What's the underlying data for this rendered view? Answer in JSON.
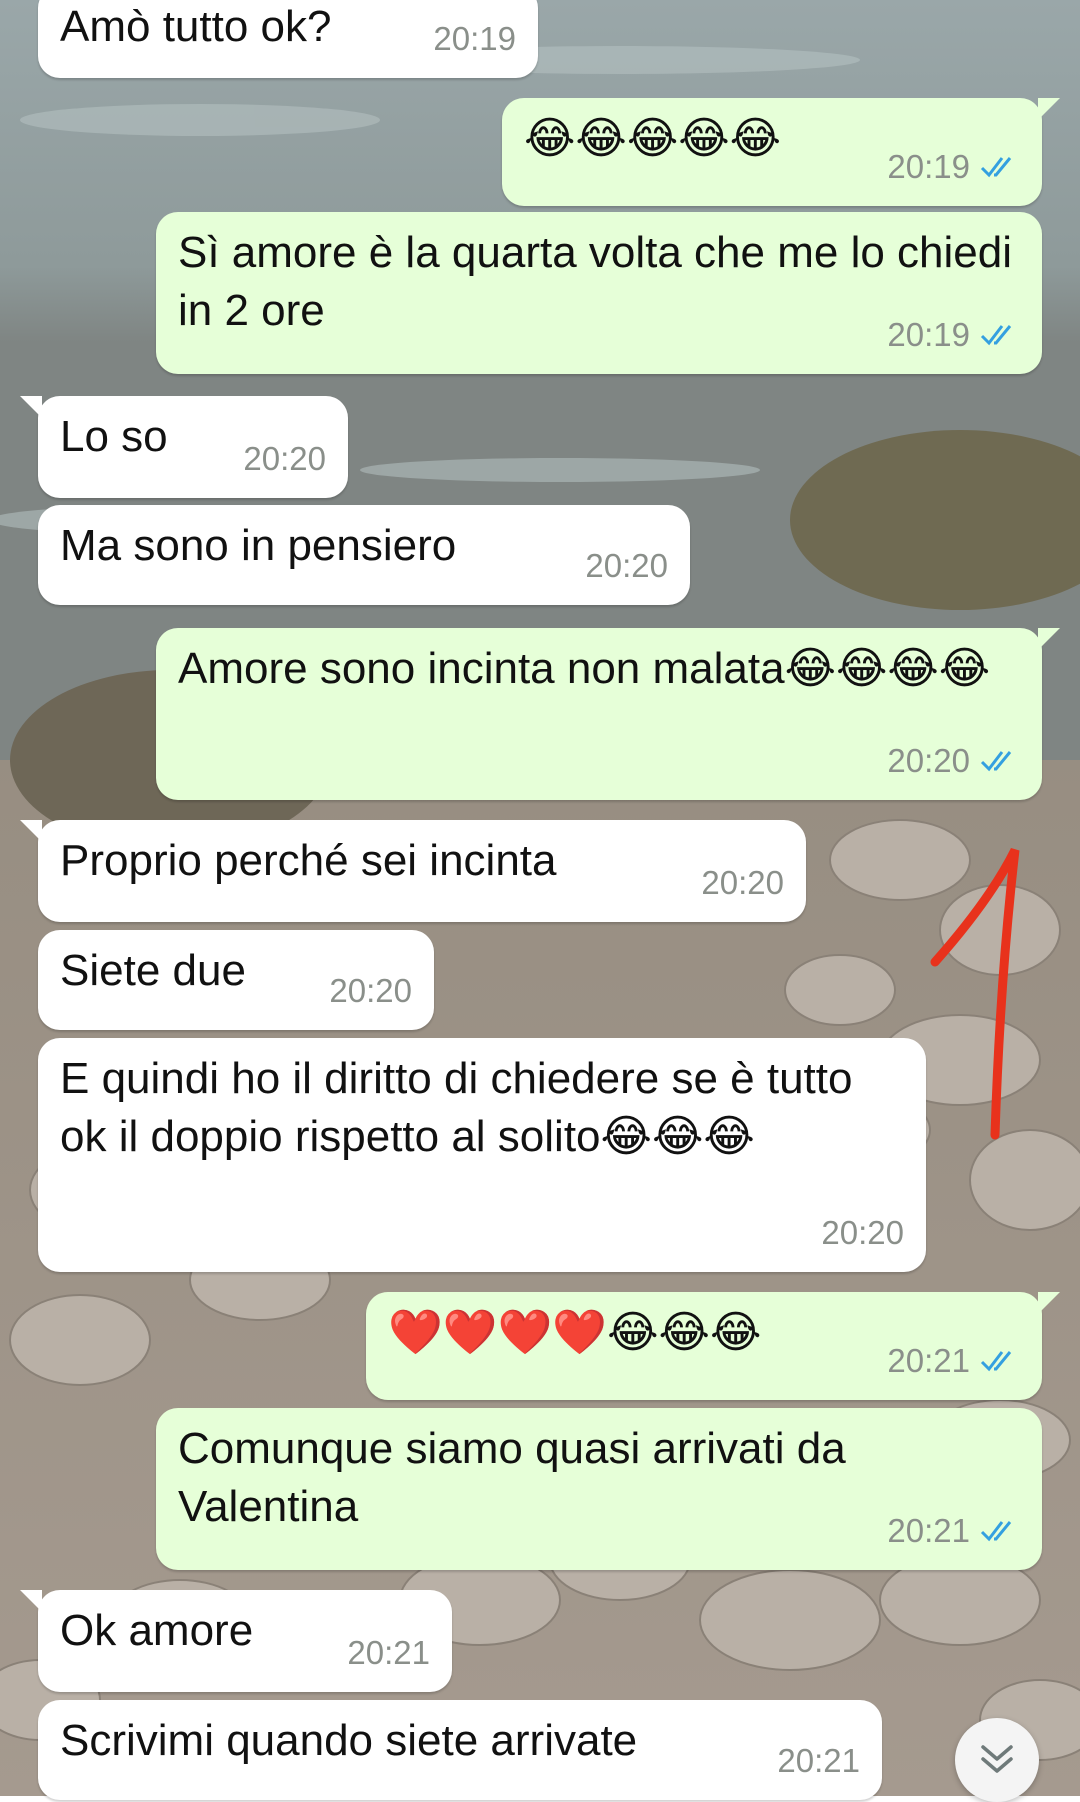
{
  "theme": {
    "incoming_bg": "#ffffff",
    "outgoing_bg": "#e6ffd8",
    "tick_color": "#34a0e0",
    "time_color": "#8a8f8a",
    "annotation_color": "#e8321c"
  },
  "messages": [
    {
      "dir": "in",
      "text": "Amò tutto ok?",
      "time": "20:19"
    },
    {
      "dir": "out",
      "text": "😂😂😂😂😂",
      "time": "20:19",
      "read": true
    },
    {
      "dir": "out",
      "text": "Sì amore è la quarta volta che me lo chiedi in 2 ore",
      "time": "20:19",
      "read": true
    },
    {
      "dir": "in",
      "text": "Lo so",
      "time": "20:20"
    },
    {
      "dir": "in",
      "text": "Ma sono in pensiero",
      "time": "20:20"
    },
    {
      "dir": "out",
      "text": "Amore sono incinta non malata😂😂😂😂",
      "time": "20:20",
      "read": true
    },
    {
      "dir": "in",
      "text": "Proprio perché sei incinta",
      "time": "20:20"
    },
    {
      "dir": "in",
      "text": "Siete due",
      "time": "20:20"
    },
    {
      "dir": "in",
      "text": "E quindi ho il diritto di chiedere se è tutto ok il doppio rispetto al solito😂😂😂",
      "time": "20:20"
    },
    {
      "dir": "out",
      "text": "❤️❤️❤️❤️😂😂😂",
      "time": "20:21",
      "read": true
    },
    {
      "dir": "out",
      "text": "Comunque siamo quasi arrivati da Valentina",
      "time": "20:21",
      "read": true
    },
    {
      "dir": "in",
      "text": "Ok amore",
      "time": "20:21"
    },
    {
      "dir": "in",
      "text": "Scrivimi quando siete arrivate",
      "time": "20:21"
    }
  ],
  "icons": {
    "read_ticks": "double-check-icon",
    "scroll_down": "double-chevron-down-icon",
    "annotation": "hand-drawn-number-one"
  }
}
